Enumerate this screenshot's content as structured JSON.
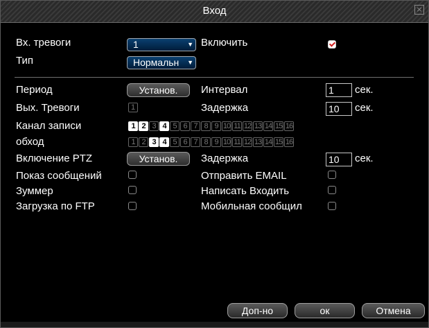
{
  "window": {
    "title": "Вход",
    "close_icon": "close-icon"
  },
  "row1": {
    "alarm_in_label": "Вх. тревоги",
    "alarm_in_value": "1",
    "enable_label": "Включить",
    "enable_checked": true
  },
  "row2": {
    "type_label": "Тип",
    "type_value": "Нормальн"
  },
  "period": {
    "label": "Период",
    "button": "Установ."
  },
  "interval": {
    "label": "Интервал",
    "value": "1",
    "unit": "сек."
  },
  "alarm_out": {
    "label": "Вых. Тревоги",
    "channel": "1"
  },
  "delay1": {
    "label": "Задержка",
    "value": "10",
    "unit": "сек."
  },
  "record_channel": {
    "label": "Канал записи",
    "channels": [
      "1",
      "2",
      "3",
      "4",
      "5",
      "6",
      "7",
      "8",
      "9",
      "10",
      "11",
      "12",
      "13",
      "14",
      "15",
      "16"
    ],
    "selected": [
      1,
      2,
      4
    ]
  },
  "tour": {
    "label": "обход",
    "channels": [
      "1",
      "2",
      "3",
      "4",
      "5",
      "6",
      "7",
      "8",
      "9",
      "10",
      "11",
      "12",
      "13",
      "14",
      "15",
      "16"
    ],
    "selected": [
      3,
      4
    ]
  },
  "ptz": {
    "label": "Включение PTZ",
    "button": "Установ."
  },
  "delay2": {
    "label": "Задержка",
    "value": "10",
    "unit": "сек."
  },
  "show_message": {
    "label": "Показ сообщений",
    "checked": false
  },
  "send_email": {
    "label": "Отправить EMAIL",
    "checked": false
  },
  "buzzer": {
    "label": "Зуммер",
    "checked": false
  },
  "write_log": {
    "label": "Написать Входить",
    "checked": false
  },
  "ftp_upload": {
    "label": "Загрузка по FTP",
    "checked": false
  },
  "mobile_msg": {
    "label": "Мобильная сообщил",
    "checked": false
  },
  "footer": {
    "advanced": "Доп-но",
    "ok": "ок",
    "cancel": "Отмена"
  },
  "colors": {
    "accent_red": "#d02020",
    "dropdown_blue": "#0a4070"
  }
}
